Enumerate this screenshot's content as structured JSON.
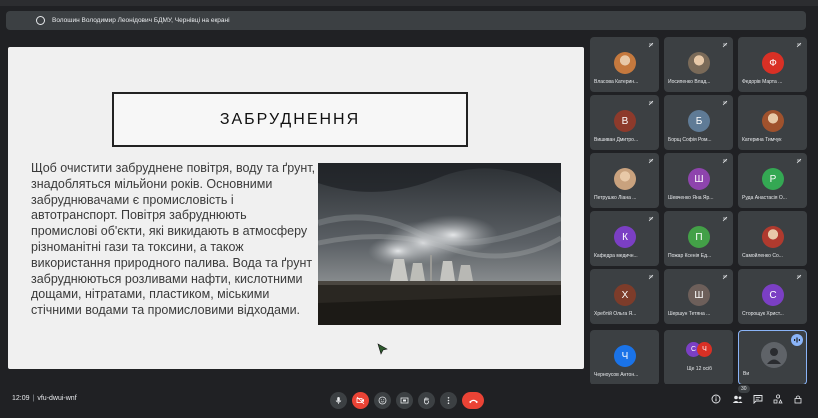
{
  "presenter": {
    "text": "Волошин Володимир Леонідович БДМУ, Чернівці на екрані"
  },
  "slide": {
    "title": "ЗАБРУДНЕННЯ",
    "body": "Щоб очистити забруднене повітря, воду та ґрунт, знадобляться мільйони років. Основними забруднювачами є промисловість і автотранспорт. Повітря забруднюють промислові об'єкти, які викидають в атмосферу різноманітні гази та токсини, а також використання природного палива. Вода та ґрунт забруднюються розливами нафти, кислотними дощами, нітратами, пластиком, міськими стічними водами та промисловими відходами."
  },
  "participants": [
    {
      "name": "Власова Катерин...",
      "initial": "",
      "color": "#c5793e",
      "photo": true
    },
    {
      "name": "Йосипенко Влад...",
      "initial": "",
      "color": "#7a6a58",
      "photo": true
    },
    {
      "name": "Федорів Марта ...",
      "initial": "Ф",
      "color": "#d93025",
      "photo": false
    },
    {
      "name": "Вишиван Дмитро...",
      "initial": "В",
      "color": "#8d3a2b",
      "photo": false
    },
    {
      "name": "Борщ Софія Ром...",
      "initial": "Б",
      "color": "#5f7b96",
      "photo": false
    },
    {
      "name": "Катерина Тимчук",
      "initial": "",
      "color": "#a0522d",
      "photo": true
    },
    {
      "name": "Петрушко Ліана ...",
      "initial": "",
      "color": "#c9a27e",
      "photo": true
    },
    {
      "name": "Шевченко Яна Яр...",
      "initial": "Ш",
      "color": "#8e44ad",
      "photo": false
    },
    {
      "name": "Руда Анастасія О...",
      "initial": "Р",
      "color": "#34a853",
      "photo": false
    },
    {
      "name": "Кафедра медичн...",
      "initial": "К",
      "color": "#7b3fc4",
      "photo": false
    },
    {
      "name": "Пожар Ксенія Ед...",
      "initial": "П",
      "color": "#43a047",
      "photo": false
    },
    {
      "name": "Самойленко Со...",
      "initial": "",
      "color": "#b03a2e",
      "photo": true
    },
    {
      "name": "Хребтій Ольга Я...",
      "initial": "Х",
      "color": "#7d3c2a",
      "photo": false
    },
    {
      "name": "Шершун Тетяна ...",
      "initial": "Ш",
      "color": "#6d5f5a",
      "photo": false
    },
    {
      "name": "Стоpощук Христ...",
      "initial": "С",
      "color": "#7b3fc4",
      "photo": false
    },
    {
      "name": "Черноусов Антон...",
      "initial": "Ч",
      "color": "#1a73e8",
      "photo": false
    }
  ],
  "more": {
    "label": "Ще 12 осіб",
    "initials": [
      "С",
      "Ч"
    ],
    "colors": [
      "#7b3fc4",
      "#d93025"
    ]
  },
  "self_tile": {
    "name": "Ви"
  },
  "bottom": {
    "time": "12:09",
    "separator": "|",
    "meeting_code": "vfu-dwui-wnf",
    "participant_count": "30"
  },
  "icons": {
    "present": "present-icon",
    "mic": "mic-icon",
    "camera_off": "camera-off-icon",
    "emoji": "emoji-icon",
    "present_screen": "present-screen-icon",
    "raise_hand": "raise-hand-icon",
    "more": "more-options-icon",
    "hangup": "hangup-icon",
    "info": "info-icon",
    "people": "people-icon",
    "chat": "chat-icon",
    "activities": "activities-icon",
    "lock": "host-controls-icon"
  }
}
